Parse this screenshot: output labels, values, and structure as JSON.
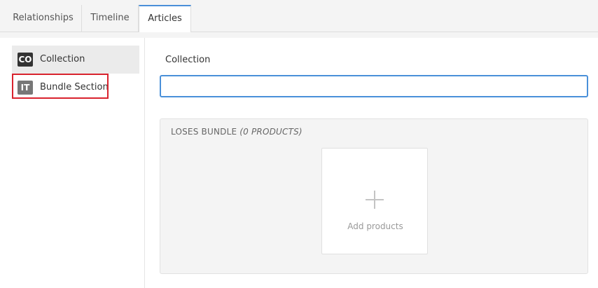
{
  "tabs": [
    {
      "label": "Relationships",
      "active": false
    },
    {
      "label": "Timeline",
      "active": false
    },
    {
      "label": "Articles",
      "active": true
    }
  ],
  "sidebar": {
    "items": [
      {
        "badge": "CO",
        "label": "Collection",
        "selected": true,
        "badge_color": "#333333"
      },
      {
        "badge": "IT",
        "label": "Bundle Section",
        "selected": false,
        "highlighted": true,
        "badge_color": "#777777"
      }
    ]
  },
  "form": {
    "collection_label": "Collection",
    "collection_value": "",
    "collection_placeholder": ""
  },
  "bundle": {
    "title": "LOSES BUNDLE",
    "count": "(0 PRODUCTS)",
    "add_label": "Add products"
  },
  "colors": {
    "accent": "#4a90d9",
    "highlight": "#d9232e"
  }
}
